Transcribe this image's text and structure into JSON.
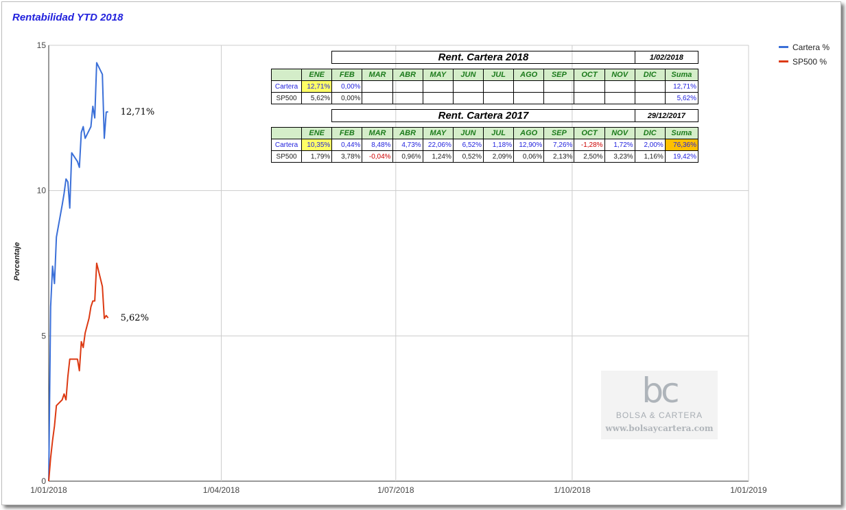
{
  "chart_data": {
    "type": "line",
    "title": "Rentabilidad YTD 2018",
    "ylabel": "Porcentaje",
    "xlabel": "",
    "ylim": [
      0,
      15
    ],
    "xlim": [
      "2018-01-01",
      "2019-01-01"
    ],
    "x_ticks": [
      "1/01/2018",
      "1/04/2018",
      "1/07/2018",
      "1/10/2018",
      "1/01/2019"
    ],
    "y_ticks": [
      "0",
      "5",
      "10",
      "15"
    ],
    "grid": true,
    "legend_position": "right",
    "series": [
      {
        "name": "Cartera %",
        "color": "#3a6fd8",
        "end_label": "12,71%",
        "points": [
          [
            "2018-01-01",
            0
          ],
          [
            "2018-01-02",
            6.0
          ],
          [
            "2018-01-03",
            7.4
          ],
          [
            "2018-01-04",
            6.8
          ],
          [
            "2018-01-05",
            8.4
          ],
          [
            "2018-01-08",
            9.5
          ],
          [
            "2018-01-09",
            9.9
          ],
          [
            "2018-01-10",
            10.4
          ],
          [
            "2018-01-11",
            10.3
          ],
          [
            "2018-01-12",
            9.4
          ],
          [
            "2018-01-13",
            11.3
          ],
          [
            "2018-01-16",
            11.0
          ],
          [
            "2018-01-17",
            10.8
          ],
          [
            "2018-01-18",
            12.0
          ],
          [
            "2018-01-19",
            12.2
          ],
          [
            "2018-01-20",
            11.8
          ],
          [
            "2018-01-23",
            12.2
          ],
          [
            "2018-01-24",
            12.9
          ],
          [
            "2018-01-25",
            12.5
          ],
          [
            "2018-01-26",
            14.4
          ],
          [
            "2018-01-29",
            14.0
          ],
          [
            "2018-01-30",
            11.8
          ],
          [
            "2018-01-31",
            12.7
          ],
          [
            "2018-02-01",
            12.71
          ]
        ]
      },
      {
        "name": "SP500 %",
        "color": "#dc3912",
        "end_label": "5,62%",
        "points": [
          [
            "2018-01-01",
            0
          ],
          [
            "2018-01-02",
            0.8
          ],
          [
            "2018-01-03",
            1.4
          ],
          [
            "2018-01-04",
            1.9
          ],
          [
            "2018-01-05",
            2.6
          ],
          [
            "2018-01-08",
            2.8
          ],
          [
            "2018-01-09",
            3.0
          ],
          [
            "2018-01-10",
            2.8
          ],
          [
            "2018-01-11",
            3.6
          ],
          [
            "2018-01-12",
            4.2
          ],
          [
            "2018-01-16",
            4.2
          ],
          [
            "2018-01-17",
            3.8
          ],
          [
            "2018-01-18",
            4.8
          ],
          [
            "2018-01-19",
            4.6
          ],
          [
            "2018-01-20",
            5.1
          ],
          [
            "2018-01-22",
            5.6
          ],
          [
            "2018-01-23",
            6.0
          ],
          [
            "2018-01-24",
            6.2
          ],
          [
            "2018-01-25",
            6.2
          ],
          [
            "2018-01-26",
            7.5
          ],
          [
            "2018-01-29",
            6.7
          ],
          [
            "2018-01-30",
            5.6
          ],
          [
            "2018-01-31",
            5.7
          ],
          [
            "2018-02-01",
            5.62
          ]
        ]
      }
    ]
  },
  "table2018": {
    "title": "Rent. Cartera 2018",
    "date": "1/02/2018",
    "headers": [
      "ENE",
      "FEB",
      "MAR",
      "ABR",
      "MAY",
      "JUN",
      "JUL",
      "AGO",
      "SEP",
      "OCT",
      "NOV",
      "DIC",
      "Suma"
    ],
    "cartera_label": "Cartera",
    "sp500_label": "SP500",
    "cartera": [
      "12,71%",
      "0,00%",
      "",
      "",
      "",
      "",
      "",
      "",
      "",
      "",
      "",
      "",
      "12,71%"
    ],
    "sp500": [
      "5,62%",
      "0,00%",
      "",
      "",
      "",
      "",
      "",
      "",
      "",
      "",
      "",
      "",
      "5,62%"
    ]
  },
  "table2017": {
    "title": "Rent. Cartera 2017",
    "date": "29/12/2017",
    "headers": [
      "ENE",
      "FEB",
      "MAR",
      "ABR",
      "MAY",
      "JUN",
      "JUL",
      "AGO",
      "SEP",
      "OCT",
      "NOV",
      "DIC",
      "Suma"
    ],
    "cartera_label": "Cartera",
    "sp500_label": "SP500",
    "cartera": [
      "10,35%",
      "0,44%",
      "8,48%",
      "4,73%",
      "22,06%",
      "6,52%",
      "1,18%",
      "12,90%",
      "7,26%",
      "-1,28%",
      "1,72%",
      "2,00%",
      "76,36%"
    ],
    "sp500": [
      "1,79%",
      "3,78%",
      "-0,04%",
      "0,96%",
      "1,24%",
      "0,52%",
      "2,09%",
      "0,06%",
      "2,13%",
      "2,50%",
      "3,23%",
      "1,16%",
      "19,42%"
    ]
  },
  "watermark": {
    "logo": "bc",
    "name": "BOLSA & CARTERA",
    "url": "www.bolsaycartera.com"
  }
}
